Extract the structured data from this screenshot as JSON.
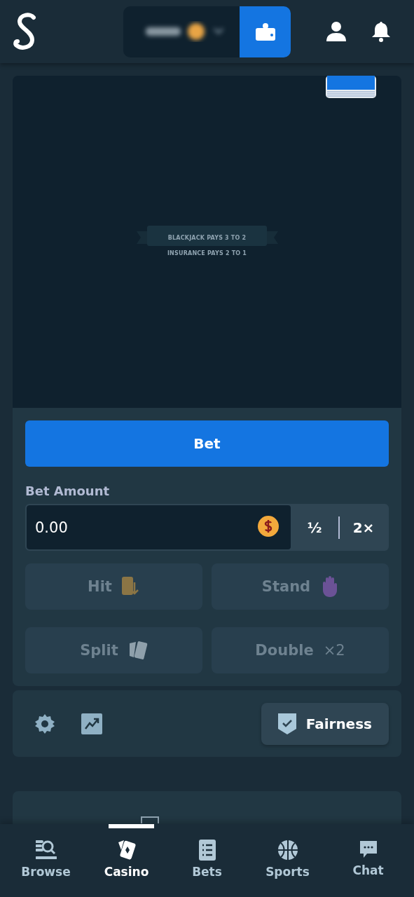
{
  "game": {
    "rules": [
      "BLACKJACK PAYS 3 TO 2",
      "INSURANCE PAYS 2 TO 1"
    ]
  },
  "bet_button": "Bet",
  "bet_amount": {
    "label": "Bet Amount",
    "value": "0.00"
  },
  "multipliers": [
    "½",
    "2×"
  ],
  "actions": [
    {
      "label": "Hit",
      "kind": "hit",
      "disabled": true
    },
    {
      "label": "Stand",
      "kind": "stand",
      "disabled": true
    },
    {
      "label": "Split",
      "kind": "split",
      "disabled": true
    },
    {
      "label": "Double",
      "kind": "double",
      "disabled": true,
      "badge": "×2"
    }
  ],
  "footer": {
    "fairness_button": "Fairness"
  },
  "nav": [
    {
      "label": "Browse",
      "kind": "browse",
      "selected": false
    },
    {
      "label": "Casino",
      "kind": "casino",
      "selected": true
    },
    {
      "label": "Bets",
      "kind": "bets",
      "selected": false
    },
    {
      "label": "Sports",
      "kind": "sports",
      "selected": false
    },
    {
      "label": "Chat",
      "kind": "chat",
      "selected": false
    }
  ]
}
